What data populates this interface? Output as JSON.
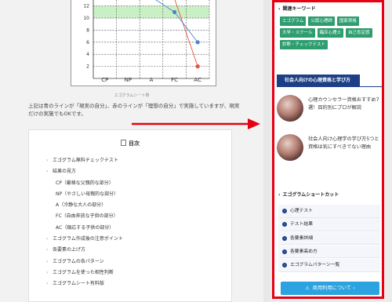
{
  "chart_data": {
    "type": "line",
    "categories": [
      "CP",
      "NP",
      "A",
      "FC",
      "AC"
    ],
    "y_ticks": [
      2,
      4,
      6,
      8,
      10,
      12
    ],
    "ylim": [
      0,
      13
    ],
    "series": [
      {
        "color": "#e8523c",
        "points": [
          {
            "x": "A",
            "y": 13.5
          },
          {
            "x": "FC",
            "y": 13.2
          },
          {
            "x": "AC",
            "y": 2
          }
        ]
      },
      {
        "color": "#4a86c8",
        "points": [
          {
            "x": "A",
            "y": 14
          },
          {
            "x": "FC",
            "y": 11
          },
          {
            "x": "AC",
            "y": 6
          }
        ]
      }
    ],
    "band": {
      "color": "#c9f0c4",
      "from": 10,
      "to": 12
    }
  },
  "main": {
    "caption": "エゴグラムシート例",
    "intro": "上記は青のラインが「現実の自分」、赤のラインが「理想の自分」で実施していますが、現実だけの実施でもOKです。",
    "toc": {
      "title": "目次",
      "items": [
        {
          "label": "エゴグラム無料チェックテスト",
          "sub": false
        },
        {
          "label": "結果の見方",
          "sub": false
        },
        {
          "label": "CP（厳格な父親的な部分）",
          "sub": true
        },
        {
          "label": "NP（やさしい母親的な部分）",
          "sub": true
        },
        {
          "label": "A（冷静な大人の部分）",
          "sub": true
        },
        {
          "label": "FC（自由奔放な子供の部分）",
          "sub": true
        },
        {
          "label": "AC（順応する子供の部分）",
          "sub": true
        },
        {
          "label": "エゴグラム作成後の注意ポイント",
          "sub": false
        },
        {
          "label": "各要素の上げ方",
          "sub": false
        },
        {
          "label": "エゴグラムの各パターン",
          "sub": false
        },
        {
          "label": "エゴグラムを使った相性判断",
          "sub": false
        },
        {
          "label": "エゴグラムシート有料版",
          "sub": false
        }
      ]
    }
  },
  "sidebar": {
    "keywords_heading": "関連キーワード",
    "tags": [
      "エゴグラム",
      "公認心理師",
      "国家資格",
      "大学・スクール",
      "臨床心理士",
      "自己肯定感",
      "診断・チェックテスト"
    ],
    "section_title": "社会人向けの心理資格と学び方",
    "articles": [
      {
        "title": "心理カウンセラー資格おすすめ7選！目的別にプロが解説"
      },
      {
        "title": "社会人向け心理学の学び方5つと資格は気にすべきでない理由"
      }
    ],
    "shortcut_heading": "エゴグラムショートカット",
    "shortcuts": [
      "心理テスト",
      "テスト結果",
      "各要素詳細",
      "各要素高め方",
      "エゴグラムパターン一覧"
    ],
    "cta_label": "商用利用について"
  }
}
